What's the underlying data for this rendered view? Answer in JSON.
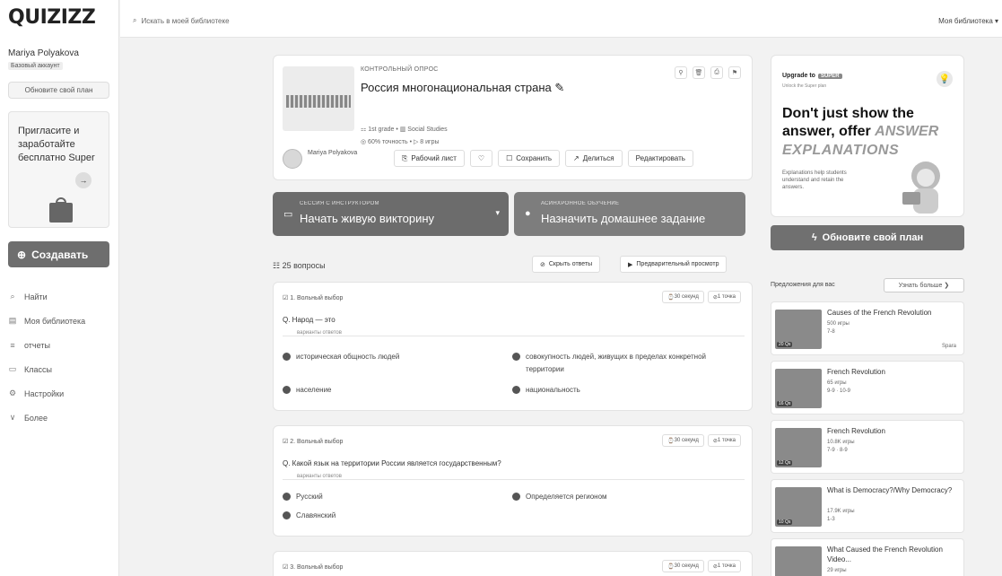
{
  "brand": {
    "logo": "QUIZIZZ"
  },
  "user": {
    "name": "Mariya Polyakova",
    "tier": "Базовый аккаунт",
    "upgrade_btn": "Обновите свой план"
  },
  "invite": {
    "title": "Пригласите и заработайте бесплатно Super",
    "arrow": "→"
  },
  "create_btn": "Создавать",
  "nav": [
    {
      "icon": "search-icon",
      "glyph": "⌕",
      "label": "Найти"
    },
    {
      "icon": "library-icon",
      "glyph": "▤",
      "label": "Моя библиотека"
    },
    {
      "icon": "reports-icon",
      "glyph": "≡",
      "label": "отчеты"
    },
    {
      "icon": "classes-icon",
      "glyph": "▭",
      "label": "Классы"
    },
    {
      "icon": "settings-icon",
      "glyph": "⚙",
      "label": "Настройки"
    },
    {
      "icon": "chevron-down-icon",
      "glyph": "∨",
      "label": "Более"
    }
  ],
  "topbar": {
    "search_placeholder": "Искать в моей библиотеке",
    "library_dropdown": "Моя библиотека ▾"
  },
  "quiz": {
    "type_label": "КОНТРОЛЬНЫЙ ОПРОС",
    "title": "Россия многонациональная страна",
    "meta1": "⚏ 1st grade   •  ▥ Social Studies",
    "meta2": "◎ 60% точность  •  ▷ 8 игры",
    "author": "Mariya Polyakova",
    "actions": [
      "Рабочий лист",
      "♡",
      "Сохранить",
      "Делиться",
      "Редактировать"
    ]
  },
  "live_btn": {
    "sub": "СЕССИЯ С ИНСТРУКТОРОМ",
    "main": "Начать живую викторину"
  },
  "hw_btn": {
    "sub": "АСИНХРОННОЕ ОБУЧЕНИЕ",
    "main": "Назначить домашнее задание"
  },
  "questions_header": {
    "count": "25 вопросы",
    "hide": "Скрыть ответы",
    "preview": "Предварительный просмотр"
  },
  "questions": [
    {
      "type": "1. Вольный выбор",
      "tags": [
        "30 секунд",
        "1 точка"
      ],
      "text": "Q. Народ — это",
      "opts_label": "варианты ответов",
      "options": [
        "историческая общность людей",
        "совокупность людей, живущих в пределах конкретной территории",
        "население",
        "национальность"
      ]
    },
    {
      "type": "2. Вольный выбор",
      "tags": [
        "30 секунд",
        "1 точка"
      ],
      "text": "Q. Какой язык на территории России является государственным?",
      "opts_label": "варианты ответов",
      "options": [
        "Русский",
        "Определяется регионом",
        "Славянский"
      ]
    },
    {
      "type": "3. Вольный выбор",
      "tags": [
        "30 секунд",
        "1 точка"
      ],
      "text": "",
      "opts_label": "",
      "options": []
    }
  ],
  "promo": {
    "tag": "Upgrade to",
    "tag_badge": "SUPER",
    "sub": "Unlock the Super plan",
    "headline": "Don't just show the answer, offer",
    "headline_italic": "ANSWER",
    "h2": "EXPLANATIONS",
    "body": "Explanations help students understand and retain the answers.",
    "upgrade_btn": "Обновите свой план"
  },
  "recommended": {
    "title": "Предложения для вас",
    "more": "Узнать больше ❯",
    "items": [
      {
        "title": "Causes of the French Revolution",
        "meta1": "500 игры",
        "meta2": "7-8",
        "dur": "20 Qs",
        "save": "Spara"
      },
      {
        "title": "French Revolution",
        "meta1": "65 игры",
        "meta2": "9-9 · 10-9",
        "dur": "16 Qs",
        "save": ""
      },
      {
        "title": "French Revolution",
        "meta1": "10.8K игры",
        "meta2": "7-9 · 8-9",
        "dur": "12 Qs",
        "save": ""
      },
      {
        "title": "What is Democracy?/Why Democracy?",
        "meta1": "17.9K игры",
        "meta2": "1-3",
        "dur": "10 Qs",
        "save": ""
      },
      {
        "title": "What Caused the French Revolution Video...",
        "meta1": "29 игры",
        "meta2": "",
        "dur": "",
        "save": ""
      }
    ]
  },
  "colors": {
    "accent": "#6e6e6e",
    "bg": "#f2f2f2"
  }
}
